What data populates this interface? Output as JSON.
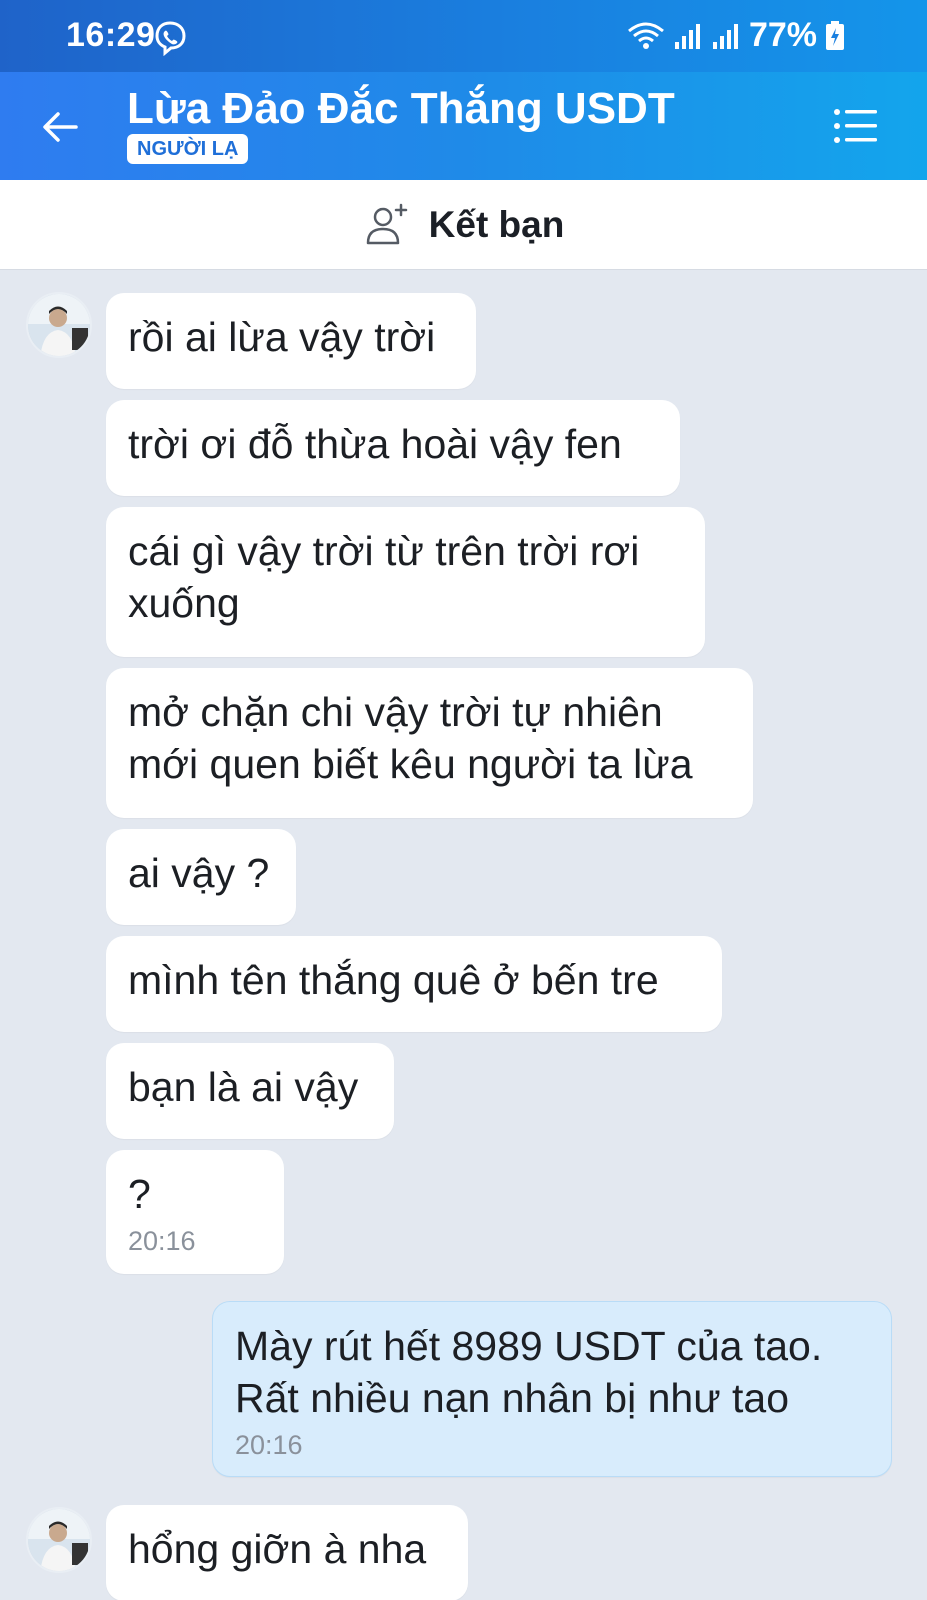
{
  "status_bar": {
    "time": "16:29",
    "battery": "77%",
    "icons": [
      "viber-icon",
      "wifi-icon",
      "signal-icon",
      "signal-icon",
      "battery-charging-icon"
    ]
  },
  "header": {
    "title": "Lừa Đảo Đắc Thắng USDT",
    "badge": "NGƯỜI LẠ",
    "back_icon": "back-arrow-icon",
    "menu_icon": "list-menu-icon"
  },
  "friend_bar": {
    "label": "Kết bạn",
    "icon": "add-friend-icon"
  },
  "messages": [
    {
      "direction": "incoming",
      "text": "rồi ai lừa vậy trời",
      "time": ""
    },
    {
      "direction": "incoming",
      "text": "trời ơi đỗ thừa hoài vậy fen",
      "time": ""
    },
    {
      "direction": "incoming",
      "text": "cái gì vậy trời từ trên trời rơi xuống",
      "time": ""
    },
    {
      "direction": "incoming",
      "text": "mở chặn chi vậy trời tự nhiên mới quen biết kêu người ta lừa",
      "time": ""
    },
    {
      "direction": "incoming",
      "text": "ai vậy ?",
      "time": ""
    },
    {
      "direction": "incoming",
      "text": "mình tên thắng quê ở bến tre",
      "time": ""
    },
    {
      "direction": "incoming",
      "text": "bạn là ai vậy",
      "time": ""
    },
    {
      "direction": "incoming",
      "text": "?",
      "time": "20:16"
    },
    {
      "direction": "outgoing",
      "text": "Mày rút hết 8989 USDT của tao. Rất nhiều nạn nhân bị như tao",
      "time": "20:16"
    },
    {
      "direction": "incoming",
      "text": "hổng giỡn à nha",
      "time": ""
    }
  ],
  "colors": {
    "header_start": "#2f7cf0",
    "header_end": "#13a5ec",
    "chat_background": "#e3e8f0",
    "incoming_bubble": "#ffffff",
    "outgoing_bubble": "#d8ecfc"
  }
}
